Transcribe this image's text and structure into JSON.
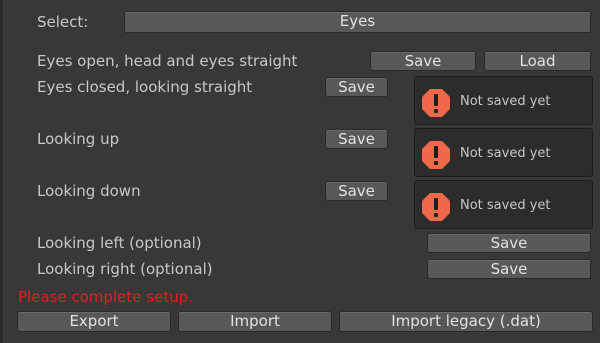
{
  "select": {
    "label": "Select:",
    "value": "Eyes"
  },
  "rows": {
    "open": {
      "label": "Eyes open, head and eyes straight",
      "save": "Save",
      "load": "Load"
    },
    "closed": {
      "label": "Eyes closed, looking straight",
      "save": "Save",
      "status": "Not saved yet"
    },
    "up": {
      "label": "Looking up",
      "save": "Save",
      "status": "Not saved yet"
    },
    "down": {
      "label": "Looking down",
      "save": "Save",
      "status": "Not saved yet"
    },
    "left": {
      "label": "Looking left (optional)",
      "save": "Save"
    },
    "right": {
      "label": "Looking right (optional)",
      "save": "Save"
    }
  },
  "error_message": "Please complete setup.",
  "footer": {
    "export": "Export",
    "import": "Import",
    "import_legacy": "Import legacy (.dat)"
  },
  "colors": {
    "background": "#383838",
    "button": "#585858",
    "error": "#e41e1e",
    "warning": "#f0684a"
  },
  "icons": {
    "warning": "exclamation-warning-icon"
  }
}
